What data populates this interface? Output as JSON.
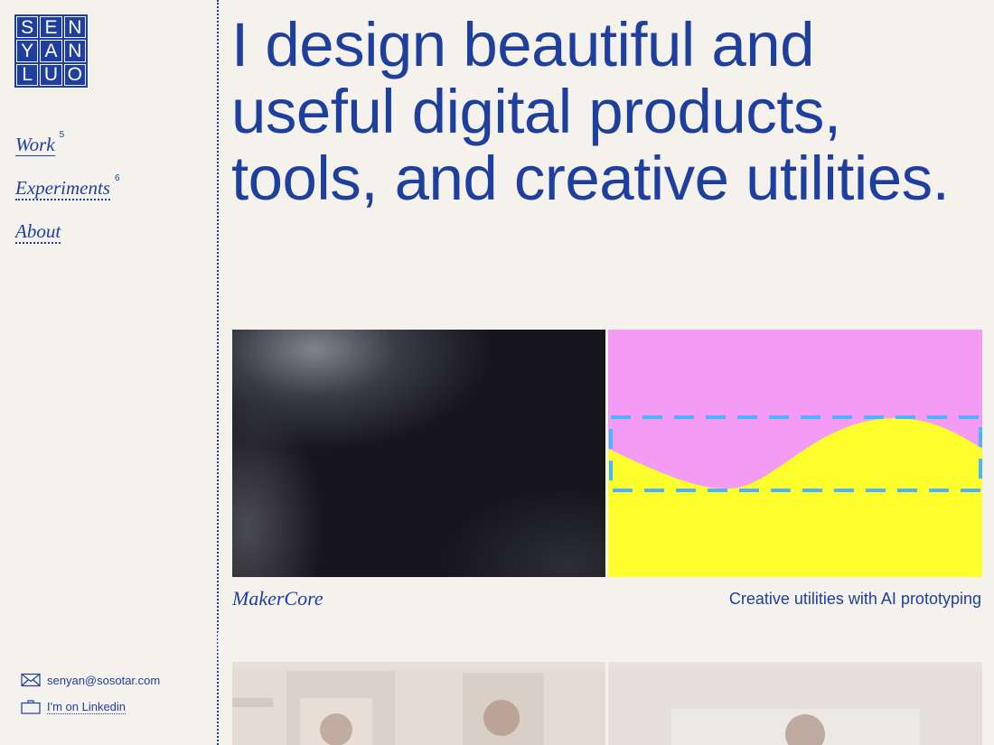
{
  "logo": {
    "letters": [
      "S",
      "E",
      "N",
      "Y",
      "A",
      "N",
      "L",
      "U",
      "O"
    ]
  },
  "nav": {
    "items": [
      {
        "label": "Work",
        "count": "5"
      },
      {
        "label": "Experiments",
        "count": "6"
      },
      {
        "label": "About"
      }
    ]
  },
  "contact": {
    "email": "senyan@sosotar.com",
    "linkedin": "I'm on Linkedin"
  },
  "hero": {
    "line1": "I design beautiful and",
    "line2": "useful digital products,",
    "line3": "tools, and creative utilities."
  },
  "project": {
    "title": "MakerCore",
    "caption": "Creative utilities with AI prototyping"
  },
  "colors": {
    "brand": "#1e3f9e",
    "background": "#f5f1ec",
    "pink": "#f39bf5",
    "yellow": "#ffff2e",
    "dash": "#4ab4ff"
  },
  "icons": {
    "email": "envelope-icon",
    "linkedin": "briefcase-icon"
  }
}
